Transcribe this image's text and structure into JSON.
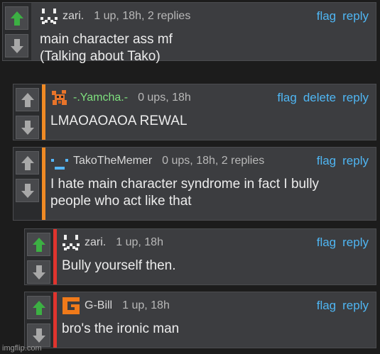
{
  "comments": [
    {
      "username": "zari.",
      "meta": "1 up, 18h, 2 replies",
      "actions": [
        "flag",
        "reply"
      ],
      "body": [
        "main character ass mf",
        "(Talking about Tako)"
      ],
      "vote_up_active": true,
      "username_color": "#d8d8d8",
      "avatar_icon": "pixel-face-icon",
      "bar_color": ""
    },
    {
      "username": "-.Yamcha.-",
      "meta": "0 ups, 18h",
      "actions": [
        "flag",
        "delete",
        "reply"
      ],
      "body": [
        "LMAOAOAOA REWAL"
      ],
      "vote_up_active": false,
      "username_color": "#7ee07e",
      "avatar_icon": "pixel-creature-icon",
      "bar_color": "#f08a24"
    },
    {
      "username": "TakoTheMemer",
      "meta": "0 ups, 18h, 2 replies",
      "actions": [
        "flag",
        "reply"
      ],
      "body": [
        "I hate main character syndrome in fact I bully",
        "people who act like that"
      ],
      "vote_up_active": false,
      "username_color": "#d8d8d8",
      "avatar_icon": "pixel-dash-face-icon",
      "bar_color": "#f08a24"
    },
    {
      "username": "zari.",
      "meta": "1 up, 18h",
      "actions": [
        "flag",
        "reply"
      ],
      "body": [
        "Bully yourself then."
      ],
      "vote_up_active": true,
      "username_color": "#d8d8d8",
      "avatar_icon": "pixel-face-icon",
      "bar_color": "#e0342e"
    },
    {
      "username": "G-Bill",
      "meta": "1 up, 18h",
      "actions": [
        "flag",
        "reply"
      ],
      "body": [
        "bro's the ironic man"
      ],
      "vote_up_active": true,
      "username_color": "#d8d8d8",
      "avatar_icon": "orange-g-logo-icon",
      "bar_color": "#e0342e"
    }
  ],
  "watermark": "imgflip.com",
  "colors": {
    "link": "#4fb6f3",
    "upvote_active": "#3cb043",
    "vote_inactive": "#a8a8a8"
  }
}
